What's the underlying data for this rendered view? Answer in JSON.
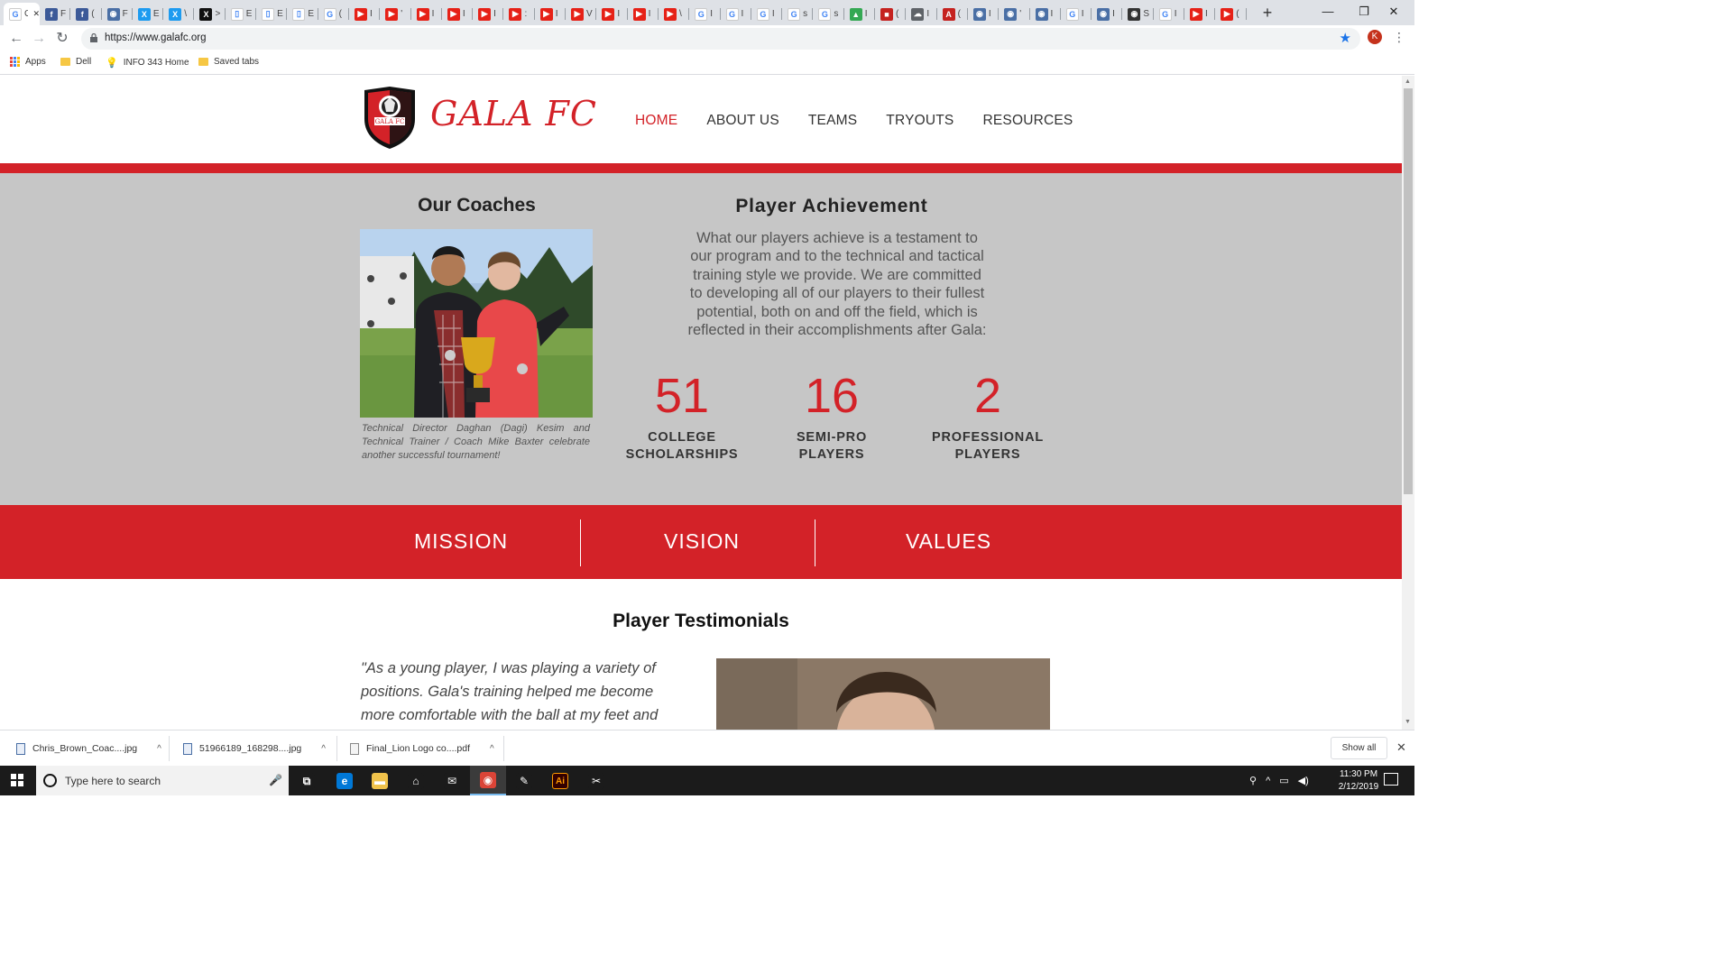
{
  "browser": {
    "tabs": [
      {
        "icon": "page-icon",
        "color": "#ffffff",
        "glyph": "G",
        "text": "G",
        "active": true
      },
      {
        "icon": "facebook-icon",
        "color": "#3b5998",
        "glyph": "f",
        "text": "F"
      },
      {
        "icon": "facebook-icon",
        "color": "#3b5998",
        "glyph": "f",
        "text": "("
      },
      {
        "icon": "globe-icon",
        "color": "#4a6fa5",
        "glyph": "◉",
        "text": "F"
      },
      {
        "icon": "x-icon",
        "color": "#1d9bf0",
        "glyph": "X",
        "text": "E"
      },
      {
        "icon": "x-icon",
        "color": "#1d9bf0",
        "glyph": "X",
        "text": "\\"
      },
      {
        "icon": "x-icon",
        "color": "#111111",
        "glyph": "X",
        "text": ">"
      },
      {
        "icon": "doc-icon",
        "color": "#ffffff",
        "glyph": "▯",
        "text": "E"
      },
      {
        "icon": "doc-icon",
        "color": "#ffffff",
        "glyph": "▯",
        "text": "E"
      },
      {
        "icon": "doc-icon",
        "color": "#ffffff",
        "glyph": "▯",
        "text": "E"
      },
      {
        "icon": "google-icon",
        "color": "#ffffff",
        "glyph": "G",
        "text": "("
      },
      {
        "icon": "youtube-icon",
        "color": "#e62117",
        "glyph": "▶",
        "text": "I"
      },
      {
        "icon": "youtube-icon",
        "color": "#e62117",
        "glyph": "▶",
        "text": "'"
      },
      {
        "icon": "youtube-icon",
        "color": "#e62117",
        "glyph": "▶",
        "text": "I"
      },
      {
        "icon": "youtube-icon",
        "color": "#e62117",
        "glyph": "▶",
        "text": "I"
      },
      {
        "icon": "youtube-icon",
        "color": "#e62117",
        "glyph": "▶",
        "text": "I"
      },
      {
        "icon": "youtube-icon",
        "color": "#e62117",
        "glyph": "▶",
        "text": ":"
      },
      {
        "icon": "youtube-icon",
        "color": "#e62117",
        "glyph": "▶",
        "text": "I"
      },
      {
        "icon": "youtube-icon",
        "color": "#e62117",
        "glyph": "▶",
        "text": "V"
      },
      {
        "icon": "youtube-icon",
        "color": "#e62117",
        "glyph": "▶",
        "text": "I"
      },
      {
        "icon": "youtube-icon",
        "color": "#e62117",
        "glyph": "▶",
        "text": "I"
      },
      {
        "icon": "youtube-icon",
        "color": "#e62117",
        "glyph": "▶",
        "text": "\\"
      },
      {
        "icon": "google-icon",
        "color": "#ffffff",
        "glyph": "G",
        "text": "I"
      },
      {
        "icon": "google-icon",
        "color": "#ffffff",
        "glyph": "G",
        "text": "I"
      },
      {
        "icon": "google-icon",
        "color": "#ffffff",
        "glyph": "G",
        "text": "I"
      },
      {
        "icon": "google-icon",
        "color": "#ffffff",
        "glyph": "G",
        "text": "s"
      },
      {
        "icon": "google-icon",
        "color": "#ffffff",
        "glyph": "G",
        "text": "s"
      },
      {
        "icon": "drive-icon",
        "color": "#34a853",
        "glyph": "▲",
        "text": "I"
      },
      {
        "icon": "app-icon",
        "color": "#c5221f",
        "glyph": "■",
        "text": "("
      },
      {
        "icon": "cloud-icon",
        "color": "#5f6368",
        "glyph": "☁",
        "text": "I"
      },
      {
        "icon": "acrobat-icon",
        "color": "#c5221f",
        "glyph": "A",
        "text": "("
      },
      {
        "icon": "globe-icon",
        "color": "#4a6fa5",
        "glyph": "◉",
        "text": "I"
      },
      {
        "icon": "globe-icon",
        "color": "#4a6fa5",
        "glyph": "◉",
        "text": "'"
      },
      {
        "icon": "globe-icon",
        "color": "#4a6fa5",
        "glyph": "◉",
        "text": "I"
      },
      {
        "icon": "google-icon",
        "color": "#ffffff",
        "glyph": "G",
        "text": "I"
      },
      {
        "icon": "globe-icon",
        "color": "#4a6fa5",
        "glyph": "◉",
        "text": "I"
      },
      {
        "icon": "globe-icon",
        "color": "#333333",
        "glyph": "◉",
        "text": "S"
      },
      {
        "icon": "google-icon",
        "color": "#ffffff",
        "glyph": "G",
        "text": "I"
      },
      {
        "icon": "youtube-icon",
        "color": "#e62117",
        "glyph": "▶",
        "text": "I"
      },
      {
        "icon": "youtube-icon",
        "color": "#e62117",
        "glyph": "▶",
        "text": "("
      }
    ],
    "new_tab": "+",
    "window_buttons": {
      "minimize": "—",
      "restore": "❐",
      "close": "✕"
    },
    "url": "https://www.galafc.org",
    "profile_initial": "K",
    "bookmarks": [
      {
        "label": "Apps",
        "icon": "apps-icon"
      },
      {
        "label": "Dell",
        "icon": "folder-icon"
      },
      {
        "label": "INFO 343 Home",
        "icon": "bulb-icon"
      },
      {
        "label": "Saved tabs",
        "icon": "folder-icon"
      }
    ]
  },
  "site": {
    "brand": "GALA FC",
    "crest_text": "GALA FC",
    "nav": [
      {
        "label": "HOME",
        "active": true
      },
      {
        "label": "ABOUT US"
      },
      {
        "label": "TEAMS"
      },
      {
        "label": "TRYOUTS"
      },
      {
        "label": "RESOURCES"
      }
    ],
    "accent_color": "#d32228",
    "coaches": {
      "title": "Our Coaches",
      "caption": "Technical Director Daghan (Dagi) Kesim and Technical Trainer / Coach Mike Baxter celebrate another successful tournament!"
    },
    "achievement": {
      "title": "Player Achievement",
      "text": "What our players achieve is a testament to our program and to the technical and tactical training style we provide. We are committed to developing all of our players to their fullest potential, both on and off the field, which is reflected in their accomplishments after Gala:",
      "stats": [
        {
          "number": "51",
          "label_line1": "COLLEGE",
          "label_line2": "SCHOLARSHIPS"
        },
        {
          "number": "16",
          "label_line1": "SEMI-PRO",
          "label_line2": "PLAYERS"
        },
        {
          "number": "2",
          "label_line1": "PROFESSIONAL",
          "label_line2": "PLAYERS"
        }
      ]
    },
    "mvv": [
      "MISSION",
      "VISION",
      "VALUES"
    ],
    "testimonials": {
      "title": "Player Testimonials",
      "quote": "\"As a young player, I was playing a variety of positions. Gala's training helped me become more comfortable with the ball at my feet and"
    }
  },
  "downloads": {
    "items": [
      {
        "name": "Chris_Brown_Coac....jpg"
      },
      {
        "name": "51966189_168298....jpg"
      },
      {
        "name": "Final_Lion Logo co....pdf"
      }
    ],
    "show_all": "Show all",
    "close": "✕"
  },
  "taskbar": {
    "search_placeholder": "Type here to search",
    "time": "11:30 PM",
    "date": "2/12/2019",
    "apps": [
      {
        "icon": "task-view-icon",
        "glyph": "⧉",
        "color": "#1b1b1b"
      },
      {
        "icon": "edge-icon",
        "glyph": "e",
        "color": "#0078d7"
      },
      {
        "icon": "file-explorer-icon",
        "glyph": "▬",
        "color": "#f0c24b"
      },
      {
        "icon": "store-icon",
        "glyph": "⌂",
        "color": "#1b1b1b"
      },
      {
        "icon": "mail-icon",
        "glyph": "✉",
        "color": "#1b1b1b"
      },
      {
        "icon": "chrome-icon",
        "glyph": "◉",
        "color": "#db4437",
        "active": true
      },
      {
        "icon": "paint-icon",
        "glyph": "✎",
        "color": "#1b1b1b"
      },
      {
        "icon": "illustrator-icon",
        "glyph": "Ai",
        "color": "#330000"
      },
      {
        "icon": "snip-icon",
        "glyph": "✂",
        "color": "#1b1b1b"
      }
    ]
  }
}
